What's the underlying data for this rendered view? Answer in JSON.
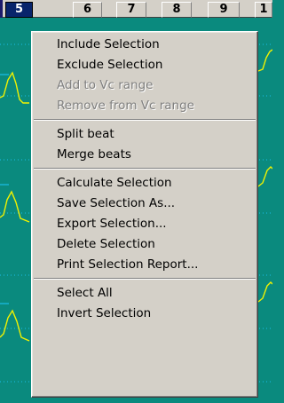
{
  "column_headers": [
    {
      "label": "5",
      "selected": true
    },
    {
      "label": "6",
      "selected": false
    },
    {
      "label": "7",
      "selected": false
    },
    {
      "label": "8",
      "selected": false
    },
    {
      "label": "9",
      "selected": false
    },
    {
      "label": "1",
      "selected": false
    }
  ],
  "colors": {
    "chart_background": "#0a8a7e",
    "waveform": "#f2f200",
    "grid": "#1ec8ff",
    "selected_header": "#08246b",
    "menu_background": "#d4d0c8",
    "disabled_text": "#808080"
  },
  "context_menu": {
    "groups": [
      [
        {
          "label": "Include Selection",
          "enabled": true
        },
        {
          "label": "Exclude Selection",
          "enabled": true
        },
        {
          "label": "Add to Vc range",
          "enabled": false
        },
        {
          "label": "Remove from Vc range",
          "enabled": false
        }
      ],
      [
        {
          "label": "Split beat",
          "enabled": true
        },
        {
          "label": "Merge beats",
          "enabled": true
        }
      ],
      [
        {
          "label": "Calculate Selection",
          "enabled": true
        },
        {
          "label": "Save Selection As...",
          "enabled": true
        },
        {
          "label": "Export Selection...",
          "enabled": true
        },
        {
          "label": "Delete Selection",
          "enabled": true
        },
        {
          "label": "Print Selection Report...",
          "enabled": true
        }
      ],
      [
        {
          "label": "Select All",
          "enabled": true
        },
        {
          "label": "Invert Selection",
          "enabled": true
        }
      ]
    ]
  }
}
